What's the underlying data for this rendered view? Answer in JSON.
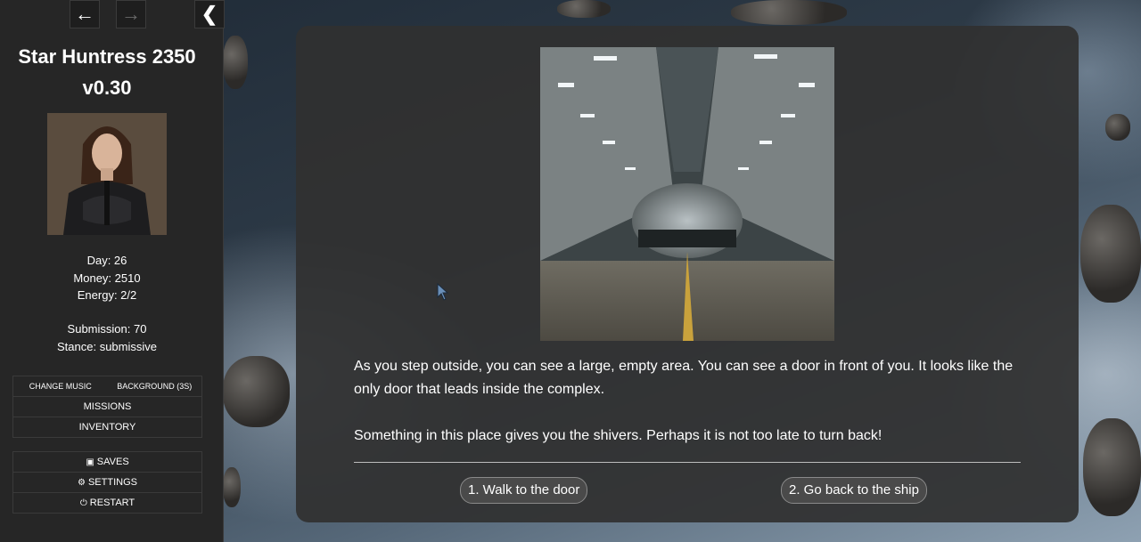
{
  "sidebar": {
    "title_line1": "Star Huntress 2350",
    "title_line2": "v0.30",
    "stats": {
      "day": "Day: 26",
      "money": "Money: 2510",
      "energy": "Energy: 2/2",
      "submission": "Submission: 70",
      "stance": "Stance: submissive"
    },
    "menu": {
      "change_music": "CHANGE MUSIC",
      "background": "BACKGROUND (3S)",
      "missions": "MISSIONS",
      "inventory": "INVENTORY",
      "saves": "SAVES",
      "settings": "SETTINGS",
      "restart": "RESTART"
    }
  },
  "story": {
    "paragraph1": "As you step outside, you can see a large, empty area. You can see a door in front of you. It looks like the only door that leads inside the complex.",
    "paragraph2": "Something in this place gives you the shivers. Perhaps it is not too late to turn back!"
  },
  "choices": [
    {
      "label": "1. Walk to the door"
    },
    {
      "label": "2. Go back to the ship"
    }
  ],
  "icons": {
    "back": "arrow-left-icon",
    "forward": "arrow-right-icon",
    "collapse": "chevron-left-icon",
    "saves": "floppy-disk-icon",
    "settings": "gear-icon",
    "restart": "power-icon"
  },
  "colors": {
    "sidebar_bg": "#262626",
    "panel_bg": "#303030",
    "text": "#ffffff"
  }
}
